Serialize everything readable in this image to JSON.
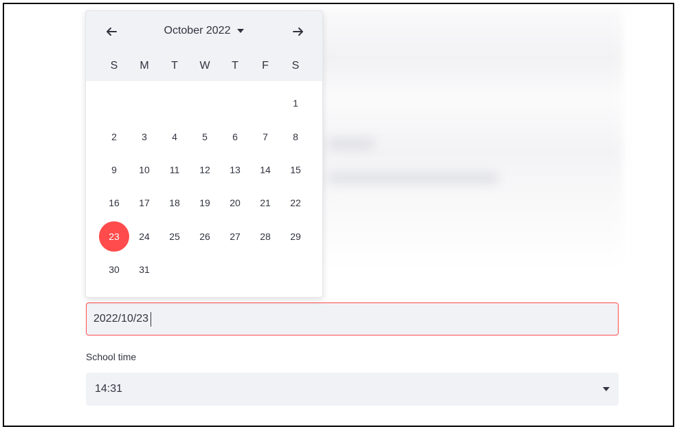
{
  "calendar": {
    "month_label": "October 2022",
    "prev_icon": "arrow-left-icon",
    "next_icon": "arrow-right-icon",
    "dropdown_icon": "caret-down-icon",
    "weekdays": [
      "S",
      "M",
      "T",
      "W",
      "T",
      "F",
      "S"
    ],
    "weeks": [
      [
        "",
        "",
        "",
        "",
        "",
        "",
        "1"
      ],
      [
        "2",
        "3",
        "4",
        "5",
        "6",
        "7",
        "8"
      ],
      [
        "9",
        "10",
        "11",
        "12",
        "13",
        "14",
        "15"
      ],
      [
        "16",
        "17",
        "18",
        "19",
        "20",
        "21",
        "22"
      ],
      [
        "23",
        "24",
        "25",
        "26",
        "27",
        "28",
        "29"
      ],
      [
        "30",
        "31",
        "",
        "",
        "",
        "",
        ""
      ]
    ],
    "selected_day": "23"
  },
  "date_input": {
    "value": "2022/10/23"
  },
  "time_field": {
    "label": "School time",
    "value": "14:31",
    "dropdown_icon": "caret-down-icon"
  },
  "colors": {
    "accent": "#ff4b4b",
    "field_background": "#f0f2f6",
    "text": "#31333f"
  }
}
